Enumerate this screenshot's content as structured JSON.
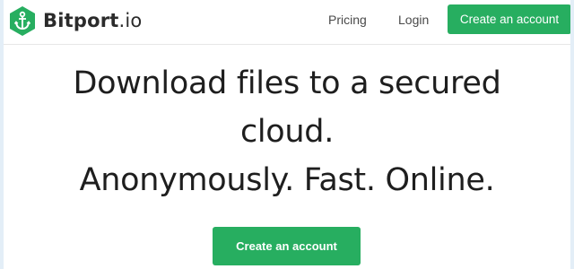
{
  "header": {
    "logo": {
      "brand": "Bitport",
      "tld": ".io",
      "icon": "anchor-hexagon-icon",
      "color": "#27ae60"
    },
    "nav": {
      "pricing": "Pricing",
      "login": "Login"
    },
    "cta_label": "Create an account"
  },
  "hero": {
    "line1": "Download files to a secured",
    "line2": "cloud.",
    "line3": "Anonymously. Fast. Online.",
    "cta_label": "Create an account"
  },
  "colors": {
    "accent": "#27ae60",
    "background": "#e3eef7"
  }
}
